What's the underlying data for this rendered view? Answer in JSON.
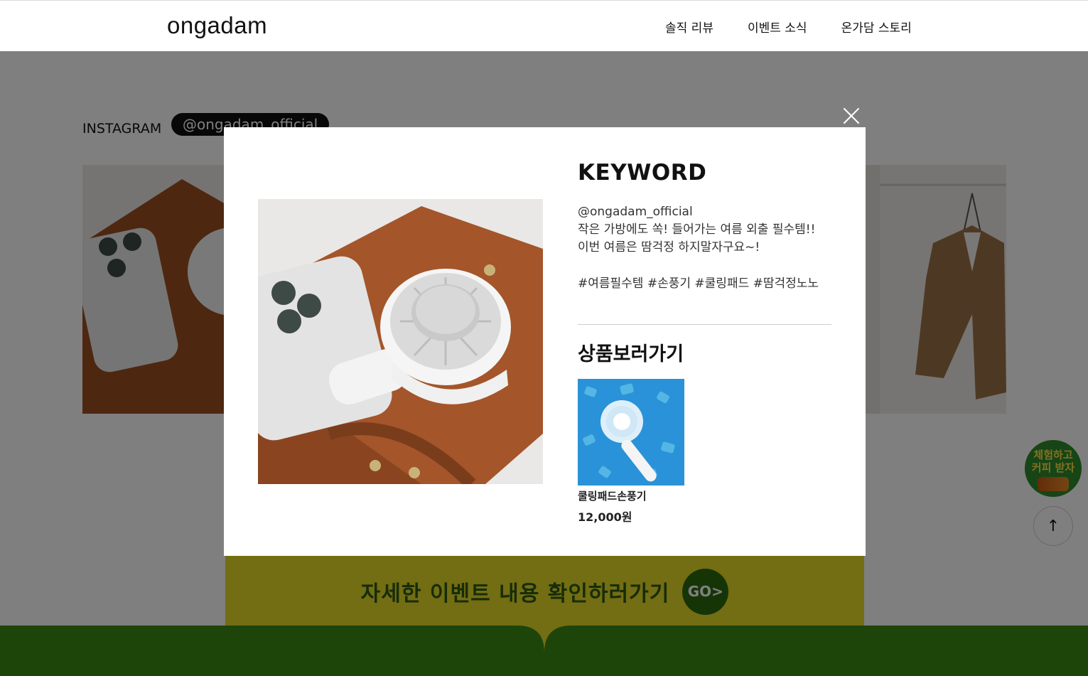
{
  "header": {
    "logo": "ongadam",
    "nav": [
      "솔직 리뷰",
      "이벤트 소식",
      "온가담 스토리"
    ]
  },
  "background": {
    "instagram_label": "INSTAGRAM",
    "instagram_handle": "@ongadam_official",
    "event_banner_text": "자세한 이벤트 내용 확인하러가기",
    "event_go": "GO>",
    "side_badge_line1": "체험하고",
    "side_badge_line2": "커피 받자",
    "top_button": "↑"
  },
  "modal": {
    "title": "KEYWORD",
    "post_lines": [
      "@ongadam_official",
      "작은 가방에도 쏙! 들어가는 여름 외출 필수템!!",
      "이번 여름은 땀걱정 하지말자구요~!"
    ],
    "hashtags": "#여름필수템 #손풍기 #쿨링패드 #땀걱정노노",
    "shop_title": "상품보러가기",
    "product": {
      "name": "쿨링패드손풍기",
      "price": "12,000원"
    }
  },
  "colors": {
    "overlay": "rgba(0,0,0,0.5)",
    "event_banner": "#e7da26",
    "event_text": "#2f5a10",
    "footer_band": "#3a8a14"
  }
}
